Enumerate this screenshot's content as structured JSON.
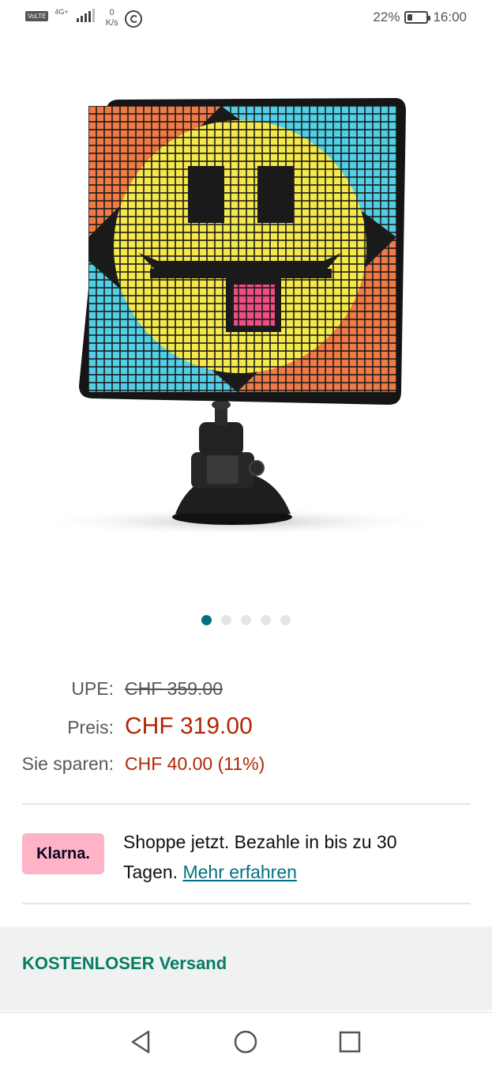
{
  "status_bar": {
    "volte": "VoLTE",
    "network": "4G+",
    "speed_value": "0",
    "speed_unit": "K/s",
    "battery": "22%",
    "time": "16:00"
  },
  "gallery": {
    "image_alt": "Pixel-Display mit Smiley auf Saugnapfhalterung",
    "slide_count": 5,
    "active_slide": 1
  },
  "price": {
    "upe_label": "UPE:",
    "upe_value": "CHF 359.00",
    "price_label": "Preis:",
    "price_value": "CHF 319.00",
    "save_label": "Sie sparen:",
    "save_value": "CHF 40.00 (11%)"
  },
  "klarna": {
    "badge": "Klarna.",
    "text": "Shoppe jetzt. Bezahle in bis zu 30 Tagen.",
    "link": "Mehr erfahren"
  },
  "shipping": {
    "text": "KOSTENLOSER Versand"
  },
  "colors": {
    "price_red": "#b12704",
    "link_teal": "#007185",
    "shipping_green": "#067d62",
    "klarna_pink": "#ffb3c7"
  },
  "nav": {
    "back": "back-icon",
    "home": "home-icon",
    "recent": "recent-apps-icon"
  }
}
